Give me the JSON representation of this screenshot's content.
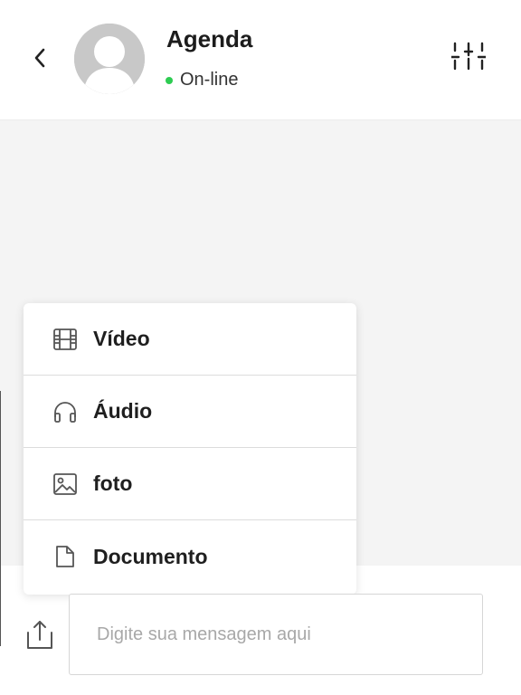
{
  "header": {
    "title": "Agenda",
    "status": "On-line",
    "status_color": "#2ecc52",
    "back_icon": "chevron-left-icon",
    "filter_icon": "sliders-icon"
  },
  "attach_menu": {
    "items": [
      {
        "label": "Vídeo",
        "icon": "film-icon"
      },
      {
        "label": "Áudio",
        "icon": "headphones-icon"
      },
      {
        "label": "foto",
        "icon": "image-icon"
      },
      {
        "label": "Documento",
        "icon": "file-icon"
      }
    ]
  },
  "composer": {
    "placeholder": "Digite sua mensagem aqui",
    "upload_icon": "upload-icon"
  }
}
